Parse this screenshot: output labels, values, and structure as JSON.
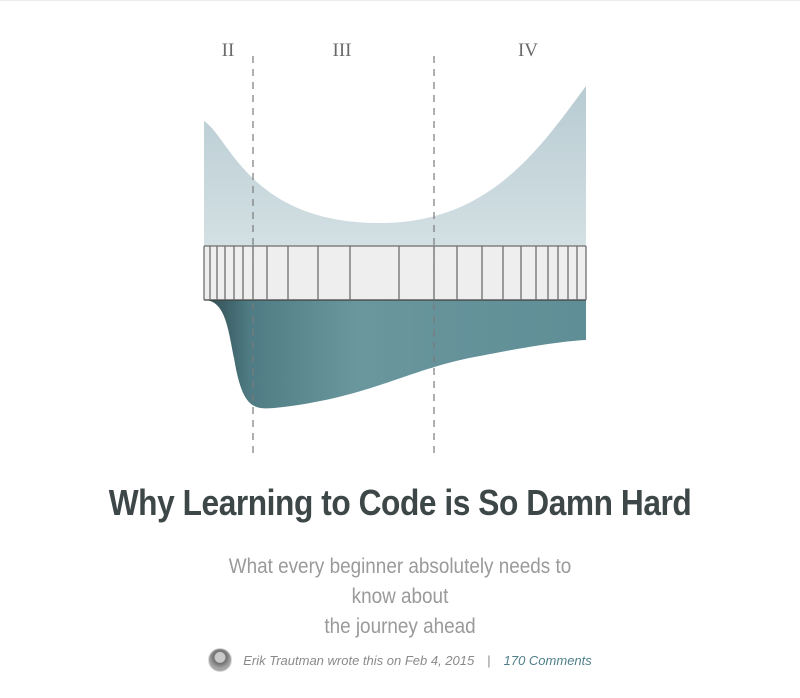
{
  "hero": {
    "stage_labels": [
      "II",
      "III",
      "IV"
    ],
    "colors": {
      "upper_fill": "#c6d6dc",
      "lower_fill": "#5f8e96",
      "lower_dark": "#2f4a4f",
      "band_fill": "#eeeeee",
      "band_line": "#6d6d6d",
      "dash_line": "#7a7a7a",
      "label_text": "#6a6a6a"
    }
  },
  "article": {
    "title": "Why Learning to Code is So Damn Hard",
    "subtitle_line1": "What every beginner absolutely needs to know about",
    "subtitle_line2": "the journey ahead",
    "byline": {
      "author_text": "Erik Trautman wrote this on Feb 4, 2015",
      "separator": "|",
      "comments_text": "170 Comments"
    },
    "colors": {
      "title": "#3e4748",
      "subtitle": "#9a9a9a",
      "link": "#4f7f8a"
    }
  }
}
